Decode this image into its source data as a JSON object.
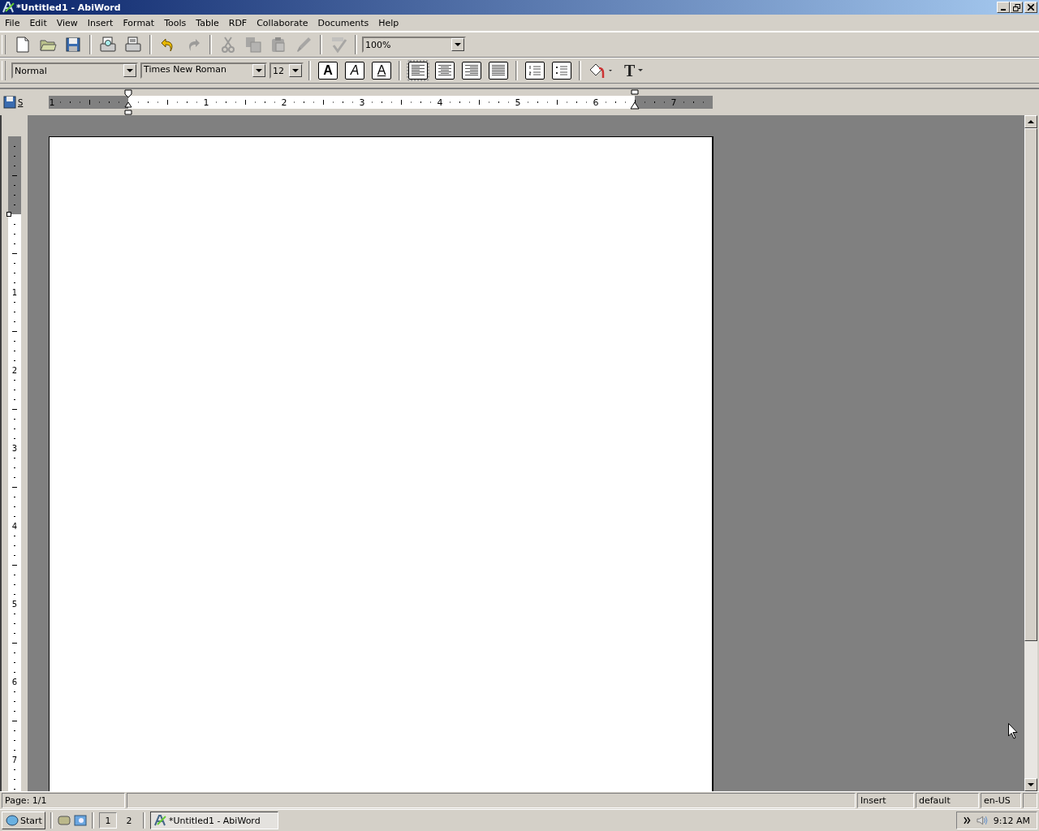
{
  "window": {
    "title": "*Untitled1 - AbiWord"
  },
  "menu": [
    "File",
    "Edit",
    "View",
    "Insert",
    "Format",
    "Tools",
    "Table",
    "RDF",
    "Collaborate",
    "Documents",
    "Help"
  ],
  "toolbar": [
    {
      "kind": "new",
      "disabled": false
    },
    {
      "kind": "open",
      "disabled": false
    },
    {
      "kind": "save",
      "disabled": false
    },
    {
      "kind": "sep"
    },
    {
      "kind": "preview",
      "disabled": false
    },
    {
      "kind": "print",
      "disabled": false
    },
    {
      "kind": "sep"
    },
    {
      "kind": "undo",
      "disabled": false
    },
    {
      "kind": "redo",
      "disabled": true
    },
    {
      "kind": "sep"
    },
    {
      "kind": "cut",
      "disabled": true
    },
    {
      "kind": "copy",
      "disabled": true
    },
    {
      "kind": "paste",
      "disabled": true
    },
    {
      "kind": "painter",
      "disabled": true
    },
    {
      "kind": "sep"
    },
    {
      "kind": "spell",
      "disabled": true
    },
    {
      "kind": "sep"
    }
  ],
  "zoom": {
    "value": "100%"
  },
  "format_bar": {
    "style": "Normal",
    "font": "Times New Roman",
    "size": "12",
    "text_buttons": [
      {
        "kind": "bold",
        "label": "A",
        "on": false
      },
      {
        "kind": "italic",
        "label": "A",
        "on": false
      },
      {
        "kind": "underline",
        "label": "A",
        "on": false
      }
    ],
    "align": [
      {
        "kind": "left",
        "selected": true
      },
      {
        "kind": "center",
        "selected": false
      },
      {
        "kind": "right",
        "selected": false
      },
      {
        "kind": "justify",
        "selected": false
      }
    ],
    "lists": [
      {
        "kind": "numbered",
        "on": false
      },
      {
        "kind": "bulleted",
        "on": false
      }
    ],
    "color_buttons": [
      {
        "kind": "fill"
      },
      {
        "kind": "text",
        "label": "T"
      }
    ]
  },
  "ruler_corner": {
    "label": "S"
  },
  "horizontal_ruler": [
    "1",
    "1",
    "2",
    "3",
    "4",
    "5",
    "6",
    "7"
  ],
  "vertical_ruler": [
    "1",
    "2",
    "3",
    "4",
    "5",
    "6",
    "7"
  ],
  "status_bar": {
    "page": "Page: 1/1",
    "mode": "Insert",
    "style": "default",
    "language": "en-US"
  },
  "taskbar": {
    "start": "Start",
    "workspaces": [
      {
        "label": "1",
        "selected": true
      },
      {
        "label": "2",
        "selected": false
      }
    ],
    "tasks": [
      {
        "label": "*Untitled1 - AbiWord",
        "selected": true
      }
    ],
    "clock": "9:12 AM"
  }
}
